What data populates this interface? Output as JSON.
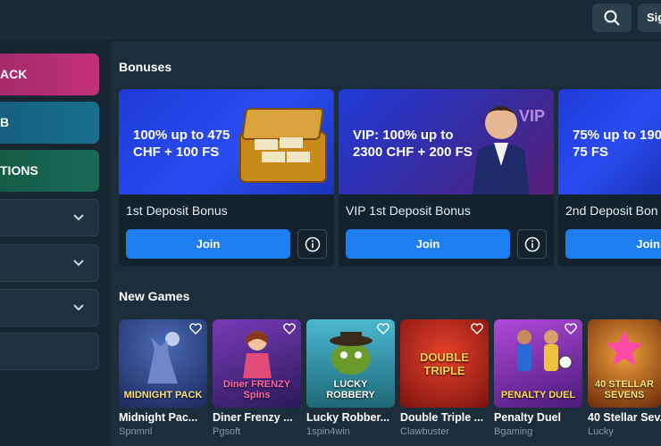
{
  "header": {
    "signin_label": "Sig"
  },
  "sidebar": {
    "buttons": [
      {
        "label": "ACK",
        "color": "#c2317a"
      },
      {
        "label": "B",
        "color": "#1a6f8f"
      },
      {
        "label": "TIONS",
        "color": "#1a6b53"
      }
    ]
  },
  "bonuses": {
    "title": "Bonuses",
    "cards": [
      {
        "headline": "100% up to 475 CHF + 100 FS",
        "name": "1st Deposit Bonus",
        "join_label": "Join"
      },
      {
        "headline": "VIP: 100% up to 2300 CHF + 200 FS",
        "name": "VIP 1st Deposit Bonus",
        "join_label": "Join"
      },
      {
        "headline": "75% up to 190 + 75 FS",
        "name": "2nd Deposit Bon",
        "join_label": "Join"
      }
    ]
  },
  "new_games": {
    "title": "New Games",
    "items": [
      {
        "name": "Midnight Pac...",
        "provider": "Spnmnl",
        "art": "MIDNIGHT PACK",
        "color": "#2a3f7a"
      },
      {
        "name": "Diner Frenzy ...",
        "provider": "Pgsoft",
        "art": "Diner FRENZY Spins",
        "color": "#5b2a78"
      },
      {
        "name": "Lucky Robber...",
        "provider": "1spin4win",
        "art": "LUCKY ROBBERY",
        "color": "#2d8a9e"
      },
      {
        "name": "Double Triple ...",
        "provider": "Clawbuster",
        "art": "DOUBLE TRIPLE",
        "color": "#b0241c"
      },
      {
        "name": "Penalty Duel",
        "provider": "Bgaming",
        "art": "PENALTY DUEL",
        "color": "#7a3aa8"
      },
      {
        "name": "40 Stellar Sev...",
        "provider": "Lucky",
        "art": "40 STELLAR SEVENS",
        "color": "#a8631a"
      }
    ]
  }
}
